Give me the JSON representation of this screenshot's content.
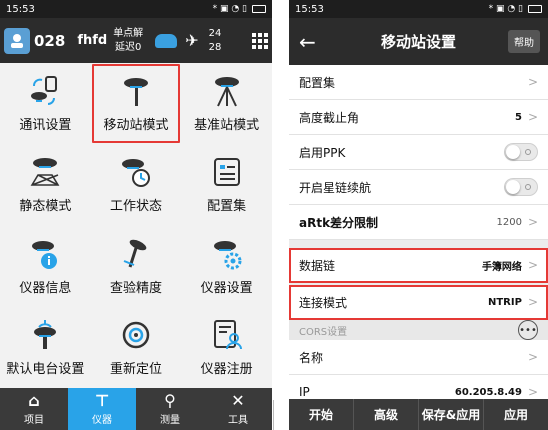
{
  "left": {
    "status": {
      "time": "15:53",
      "icons": "* ▣ ◔ ▯"
    },
    "header": {
      "num": "028",
      "name": "fhfd",
      "solution": "单点解",
      "delay": "延迟0",
      "sat_top": "24",
      "sat_bottom": "28"
    },
    "grid": [
      {
        "label": "通讯设置",
        "icon": "comm-settings-icon"
      },
      {
        "label": "移动站模式",
        "icon": "rover-mode-icon"
      },
      {
        "label": "基准站模式",
        "icon": "base-mode-icon"
      },
      {
        "label": "静态模式",
        "icon": "static-mode-icon"
      },
      {
        "label": "工作状态",
        "icon": "work-status-icon"
      },
      {
        "label": "配置集",
        "icon": "config-set-icon"
      },
      {
        "label": "仪器信息",
        "icon": "device-info-icon"
      },
      {
        "label": "查验精度",
        "icon": "check-accuracy-icon"
      },
      {
        "label": "仪器设置",
        "icon": "device-settings-icon"
      },
      {
        "label": "默认电台设置",
        "icon": "radio-settings-icon"
      },
      {
        "label": "重新定位",
        "icon": "relocate-icon"
      },
      {
        "label": "仪器注册",
        "icon": "device-register-icon"
      }
    ],
    "nav": [
      {
        "label": "项目",
        "glyph": "⌂"
      },
      {
        "label": "仪器",
        "glyph": "⊤"
      },
      {
        "label": "测量",
        "glyph": "⚲"
      },
      {
        "label": "工具",
        "glyph": "✕"
      }
    ]
  },
  "right": {
    "status": {
      "time": "15:53",
      "icons": "* ▣ ◔ ▯"
    },
    "header": {
      "back": "←",
      "title": "移动站设置",
      "help": "帮助"
    },
    "rows": {
      "config_set": {
        "label": "配置集"
      },
      "elevation": {
        "label": "高度截止角",
        "value": "5"
      },
      "ppk": {
        "label": "启用PPK"
      },
      "continuation": {
        "label": "开启星链续航"
      },
      "artk": {
        "label": "aRtk差分限制",
        "value": "1200"
      },
      "datalink": {
        "label": "数据链",
        "value": "手簿网络"
      },
      "connection": {
        "label": "连接模式",
        "value": "NTRIP"
      },
      "cors_section": {
        "label": "CORS设置",
        "more": "•••"
      },
      "name": {
        "label": "名称"
      },
      "ip": {
        "label": "IP",
        "value": "60.205.8.49"
      }
    },
    "bottom": {
      "start": "开始",
      "advanced": "高级",
      "save_apply": "保存&应用",
      "apply": "应用"
    }
  }
}
